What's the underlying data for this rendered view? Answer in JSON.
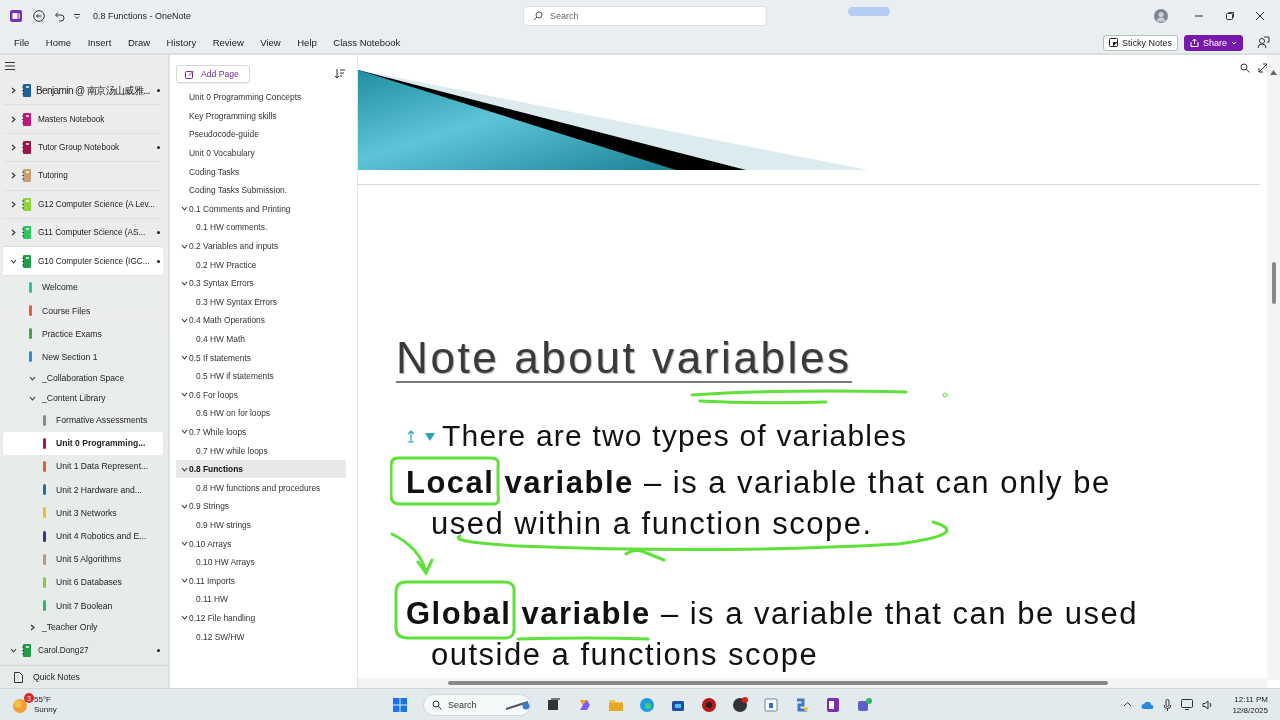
{
  "window": {
    "title": "0.8 Functions - OneNote"
  },
  "search": {
    "placeholder": "Search"
  },
  "menu": [
    "File",
    "Home",
    "Insert",
    "Draw",
    "History",
    "Review",
    "View",
    "Help",
    "Class Notebook"
  ],
  "ribbon_buttons": [
    {
      "label": "Sticky Notes",
      "kind": "sticky"
    },
    {
      "label": "Share",
      "kind": "share"
    }
  ],
  "notebooks": [
    {
      "kind": "notebook",
      "name": "Benjamin @ 南京汤山威雅...",
      "color": "#1f5f9a",
      "expanded": false,
      "dot": true,
      "selected": false
    },
    {
      "kind": "notebook",
      "name": "Masters Notebook",
      "color": "#c0167a",
      "expanded": false,
      "dot": false,
      "selected": false
    },
    {
      "kind": "notebook",
      "name": "Tutor Group Notebook",
      "color": "#a0124a",
      "expanded": false,
      "dot": true,
      "selected": false
    },
    {
      "kind": "notebook",
      "name": "Tutoring",
      "color": "#c8a070",
      "expanded": false,
      "dot": false,
      "selected": false
    },
    {
      "kind": "notebook",
      "name": "G12 Computer Science (A Lev...",
      "color": "#8cd63a",
      "expanded": false,
      "dot": false,
      "selected": false
    },
    {
      "kind": "notebook",
      "name": "G11 Computer Science (AS...",
      "color": "#2cc860",
      "expanded": false,
      "dot": true,
      "selected": false
    },
    {
      "kind": "notebook",
      "name": "G10 Computer Science (IGC...",
      "color": "#1e9e48",
      "expanded": true,
      "dot": true,
      "selected": true,
      "children": [
        {
          "kind": "section",
          "name": "Welcome",
          "color": "#2dbfa0",
          "selected": false
        },
        {
          "kind": "section",
          "name": "Course Files",
          "color": "#e0622a",
          "selected": false
        },
        {
          "kind": "section",
          "name": "Practice Exams",
          "color": "#3aa84a",
          "selected": false
        },
        {
          "kind": "section",
          "name": "New Section 1",
          "color": "#2a8fc8",
          "selected": false
        },
        {
          "kind": "group",
          "name": "_Collaboration Space",
          "expanded": true
        },
        {
          "kind": "group",
          "name": "_Content Library",
          "expanded": true,
          "children": [
            {
              "kind": "section",
              "name": "Formative Assessments",
              "color": "#8a8a8a",
              "selected": false
            },
            {
              "kind": "section",
              "name": "Unit 0 Programming...",
              "color": "#b0143a",
              "selected": true
            },
            {
              "kind": "section",
              "name": "Unit 1 Data Represent...",
              "color": "#e0622a",
              "selected": false
            },
            {
              "kind": "section",
              "name": "Unit 2 Hardware and...",
              "color": "#1f6fa8",
              "selected": false
            },
            {
              "kind": "section",
              "name": "Unit 3 Networks",
              "color": "#e8c02a",
              "selected": false
            },
            {
              "kind": "section",
              "name": "Unit 4 Robotics and E...",
              "color": "#4a2a8a",
              "selected": false
            },
            {
              "kind": "section",
              "name": "Unit 5 Algorithms",
              "color": "#b89a80",
              "selected": false
            },
            {
              "kind": "section",
              "name": "Unit 6 Databases",
              "color": "#8cc83a",
              "selected": false
            },
            {
              "kind": "section",
              "name": "Unit 7 Boolean",
              "color": "#2ab860",
              "selected": false
            }
          ]
        },
        {
          "kind": "group",
          "name": "_Teacher Only",
          "expanded": false
        }
      ]
    },
    {
      "kind": "notebook",
      "name": "Carol.Dong27",
      "color": "#1e9e48",
      "expanded": true,
      "dot": true,
      "selected": false
    }
  ],
  "quick_notes": "Quick Notes",
  "add_page": "Add Page",
  "pages": [
    {
      "title": "Unit 0 Programming Concepts",
      "selected": false
    },
    {
      "title": "Key Programming skills",
      "selected": false
    },
    {
      "title": "Pseudocode-guide",
      "selected": false
    },
    {
      "title": "Unit 0 Vocabulary",
      "selected": false
    },
    {
      "title": "Coding Tasks",
      "selected": false
    },
    {
      "title": "Coding Tasks Submission.",
      "selected": false
    },
    {
      "title": "0.1 Comments and Printing",
      "selected": false,
      "expanded": true,
      "children": [
        {
          "title": "0.1 HW comments.",
          "selected": false
        }
      ]
    },
    {
      "title": "0.2 Variables and inputs",
      "selected": false,
      "expanded": true,
      "children": [
        {
          "title": "0.2 HW Practice",
          "selected": false
        }
      ]
    },
    {
      "title": "0.3 Syntax Errors",
      "selected": false,
      "expanded": true,
      "children": [
        {
          "title": "0.3 HW Syntax Errors",
          "selected": false
        }
      ]
    },
    {
      "title": "0.4 Math Operations",
      "selected": false,
      "expanded": true,
      "children": [
        {
          "title": "0.4 HW Math",
          "selected": false
        }
      ]
    },
    {
      "title": "0.5 If statements",
      "selected": false,
      "expanded": true,
      "children": [
        {
          "title": "0.5 HW if statements",
          "selected": false
        }
      ]
    },
    {
      "title": "0.6 For loops",
      "selected": false,
      "expanded": true,
      "children": [
        {
          "title": "0.6 HW on for loops",
          "selected": false
        }
      ]
    },
    {
      "title": "0.7 While loops",
      "selected": false,
      "expanded": true,
      "children": [
        {
          "title": "0.7 HW while loops",
          "selected": false
        }
      ]
    },
    {
      "title": "0.8 Functions",
      "selected": true,
      "expanded": true,
      "children": [
        {
          "title": "0.8 HW functions and procedures",
          "selected": false
        }
      ]
    },
    {
      "title": "0.9 Strings",
      "selected": false,
      "expanded": true,
      "children": [
        {
          "title": "0.9 HW strings",
          "selected": false
        }
      ]
    },
    {
      "title": "0.10 Arrays",
      "selected": false,
      "expanded": true,
      "children": [
        {
          "title": "0.10 HW Arrays",
          "selected": false
        }
      ]
    },
    {
      "title": "0.11 Imports",
      "selected": false,
      "expanded": true,
      "children": [
        {
          "title": "0.11 HW",
          "selected": false
        }
      ]
    },
    {
      "title": "0.12 File handling",
      "selected": false,
      "expanded": true,
      "children": [
        {
          "title": "0.12 SW/HW",
          "selected": false
        }
      ]
    }
  ],
  "note": {
    "heading": "Note about variables",
    "bullet": "There are two types of variables",
    "definitions": [
      "**Local variable** – is a variable that can only be used within a function scope.",
      "**Global variable** – is a variable that can be used outside a functions scope"
    ]
  },
  "taskbar": {
    "weather_badge": "3",
    "temperature": "55°F",
    "condition": "Sunny",
    "search": "Search",
    "time": "12:11 PM",
    "date": "12/8/2025"
  }
}
